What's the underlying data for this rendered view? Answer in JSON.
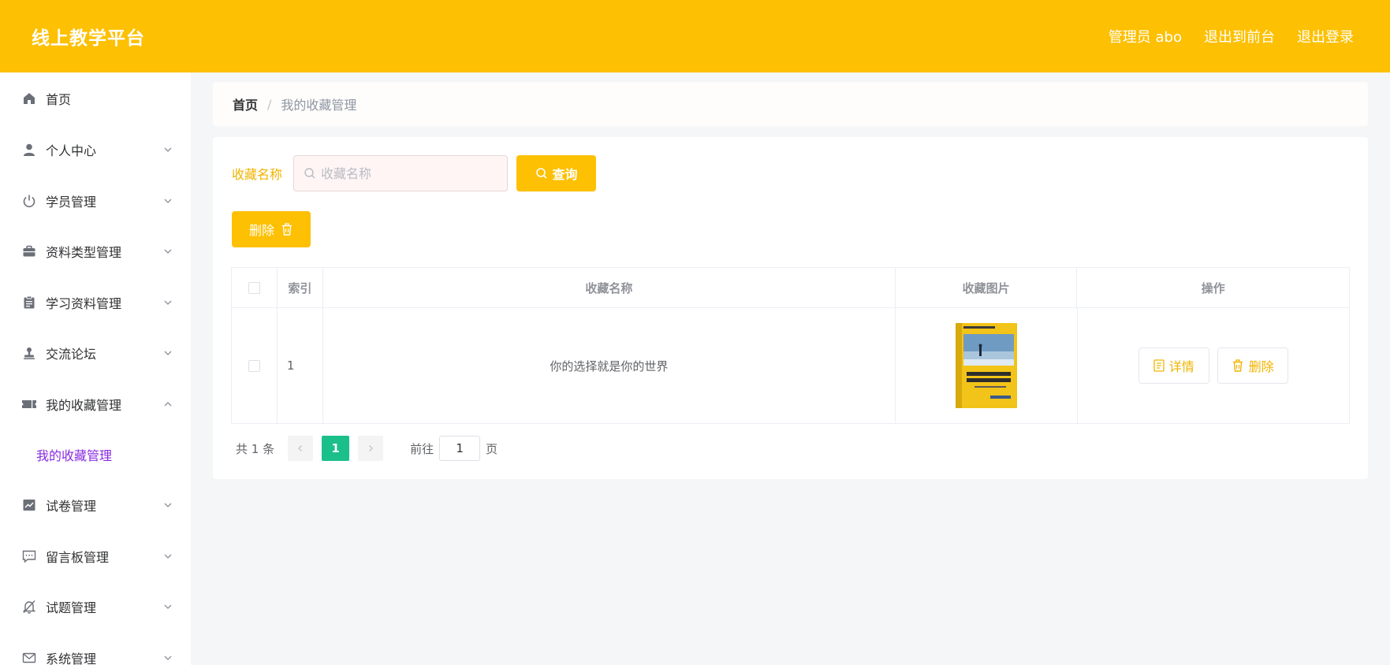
{
  "header": {
    "title": "线上教学平台",
    "user": "管理员 abo",
    "to_front": "退出到前台",
    "logout": "退出登录",
    "bg_color": "#fdc002"
  },
  "sidebar": {
    "items": [
      {
        "label": "首页",
        "icon": "home-icon"
      },
      {
        "label": "个人中心",
        "icon": "user-icon"
      },
      {
        "label": "学员管理",
        "icon": "power-icon"
      },
      {
        "label": "资料类型管理",
        "icon": "briefcase-icon"
      },
      {
        "label": "学习资料管理",
        "icon": "clipboard-icon"
      },
      {
        "label": "交流论坛",
        "icon": "stamp-icon"
      },
      {
        "label": "我的收藏管理",
        "icon": "ticket-icon",
        "expanded": true
      },
      {
        "label": "试卷管理",
        "icon": "chart-icon"
      },
      {
        "label": "留言板管理",
        "icon": "chat-icon"
      },
      {
        "label": "试题管理",
        "icon": "bell-off-icon"
      },
      {
        "label": "系统管理",
        "icon": "mail-icon"
      }
    ],
    "sub_item": "我的收藏管理",
    "sub_item_color": "#8a2be2"
  },
  "breadcrumb": {
    "home": "首页",
    "separator": "/",
    "current": "我的收藏管理"
  },
  "search": {
    "label": "收藏名称",
    "placeholder": "收藏名称",
    "value": "",
    "query_button": "查询"
  },
  "actions": {
    "delete_button": "删除"
  },
  "table": {
    "columns": [
      "索引",
      "收藏名称",
      "收藏图片",
      "操作"
    ],
    "rows": [
      {
        "index": "1",
        "name": "你的选择就是你的世界",
        "image": "book-cover",
        "detail": "详情",
        "delete": "删除"
      }
    ]
  },
  "pagination": {
    "total": "共 1 条",
    "current_page": "1",
    "goto_label": "前往",
    "goto_value": "1",
    "page_suffix": "页",
    "active_color": "#1bbf8a"
  }
}
